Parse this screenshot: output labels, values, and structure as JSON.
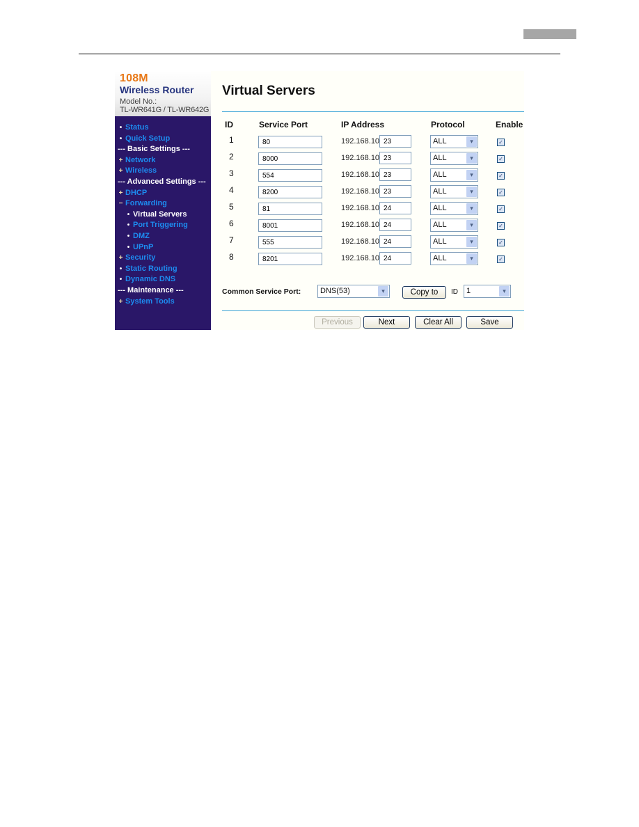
{
  "brand": {
    "line1": "108M",
    "line2": "Wireless  Router",
    "line3": "Model No.:",
    "line4": "TL-WR641G / TL-WR642G"
  },
  "menu": [
    {
      "label": "Status",
      "type": "item",
      "marker": "•"
    },
    {
      "label": "Quick Setup",
      "type": "item",
      "marker": "•"
    },
    {
      "label": "--- Basic Settings ---",
      "type": "section"
    },
    {
      "label": "Network",
      "type": "plus",
      "marker": "+"
    },
    {
      "label": "Wireless",
      "type": "plus",
      "marker": "+"
    },
    {
      "label": "--- Advanced Settings ---",
      "type": "section"
    },
    {
      "label": "DHCP",
      "type": "plus",
      "marker": "+"
    },
    {
      "label": "Forwarding",
      "type": "minus",
      "marker": "−"
    },
    {
      "label": "Virtual Servers",
      "type": "sub-active",
      "marker": "•"
    },
    {
      "label": "Port Triggering",
      "type": "sub",
      "marker": "•"
    },
    {
      "label": "DMZ",
      "type": "sub",
      "marker": "•"
    },
    {
      "label": "UPnP",
      "type": "sub",
      "marker": "•"
    },
    {
      "label": "Security",
      "type": "plus",
      "marker": "+"
    },
    {
      "label": "Static Routing",
      "type": "item",
      "marker": "•"
    },
    {
      "label": "Dynamic DNS",
      "type": "item",
      "marker": "•"
    },
    {
      "label": "--- Maintenance ---",
      "type": "section"
    },
    {
      "label": "System Tools",
      "type": "plus",
      "marker": "+"
    }
  ],
  "page": {
    "title": "Virtual Servers",
    "headers": {
      "id": "ID",
      "service_port": "Service Port",
      "ip_address": "IP Address",
      "protocol": "Protocol",
      "enable": "Enable"
    },
    "ip_prefix": "192.168.10.",
    "rows": [
      {
        "id": "1",
        "port": "80",
        "ip_last": "23",
        "protocol": "ALL",
        "enabled": true
      },
      {
        "id": "2",
        "port": "8000",
        "ip_last": "23",
        "protocol": "ALL",
        "enabled": true
      },
      {
        "id": "3",
        "port": "554",
        "ip_last": "23",
        "protocol": "ALL",
        "enabled": true
      },
      {
        "id": "4",
        "port": "8200",
        "ip_last": "23",
        "protocol": "ALL",
        "enabled": true
      },
      {
        "id": "5",
        "port": "81",
        "ip_last": "24",
        "protocol": "ALL",
        "enabled": true
      },
      {
        "id": "6",
        "port": "8001",
        "ip_last": "24",
        "protocol": "ALL",
        "enabled": true
      },
      {
        "id": "7",
        "port": "555",
        "ip_last": "24",
        "protocol": "ALL",
        "enabled": true
      },
      {
        "id": "8",
        "port": "8201",
        "ip_last": "24",
        "protocol": "ALL",
        "enabled": true
      }
    ],
    "common_service_port_label": "Common Service Port:",
    "common_service_port_value": "DNS(53)",
    "copy_to_label": "Copy to",
    "id_label": "ID",
    "id_value": "1",
    "buttons": {
      "previous": "Previous",
      "next": "Next",
      "clear_all": "Clear All",
      "save": "Save"
    }
  },
  "icons": {
    "dropdown": "▾",
    "checkmark": "✓"
  }
}
